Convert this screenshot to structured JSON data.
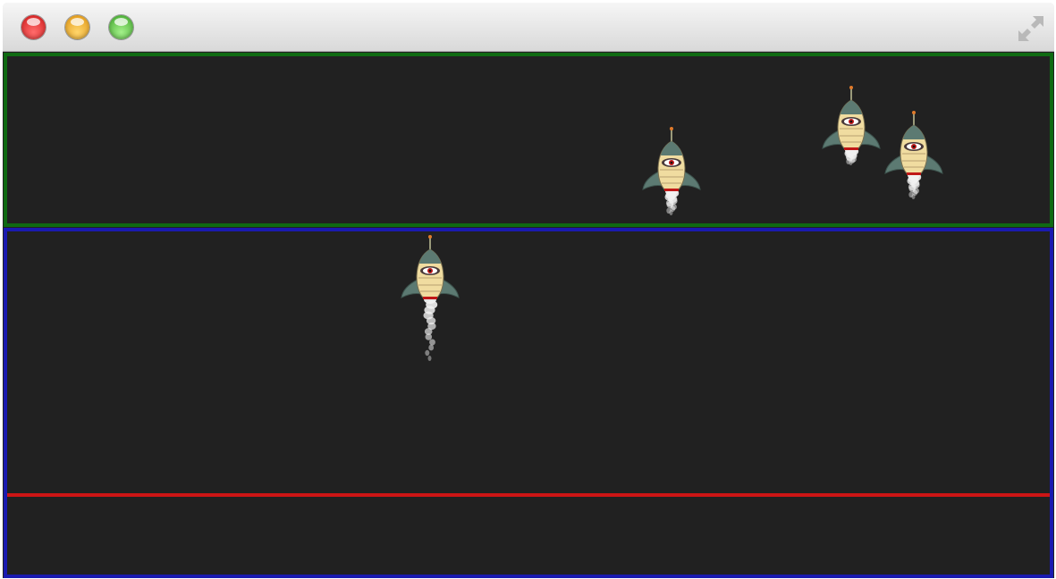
{
  "window": {
    "controls": [
      {
        "name": "close",
        "color": "#e0443e"
      },
      {
        "name": "minimize",
        "color": "#f0a327"
      },
      {
        "name": "zoom",
        "color": "#61c554"
      }
    ],
    "fullscreen_icon": "fullscreen-arrows-icon"
  },
  "game": {
    "colors": {
      "background": "#212121",
      "upper_zone_border": "#0f6a12",
      "lower_zone_border": "#1a1ab0",
      "deadline": "#cc1515"
    },
    "ships": [
      {
        "id": "ship-1",
        "icon": "alien-rocket-icon",
        "thrust": "medium"
      },
      {
        "id": "ship-2",
        "icon": "alien-rocket-icon",
        "thrust": "low"
      },
      {
        "id": "ship-3",
        "icon": "alien-rocket-icon",
        "thrust": "medium"
      },
      {
        "id": "ship-4",
        "icon": "alien-rocket-icon",
        "thrust": "high"
      }
    ]
  }
}
